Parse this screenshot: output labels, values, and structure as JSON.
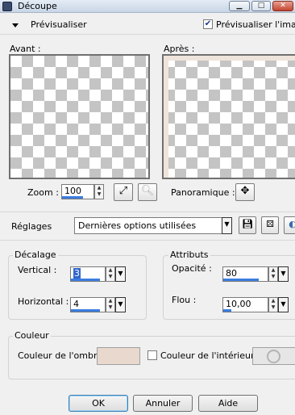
{
  "window": {
    "title": "Découpe",
    "minimize": "▁",
    "maximize": "□",
    "close": "✕"
  },
  "preview": {
    "collapse_icon": "triangle-down",
    "label": "Prévisualiser",
    "show_image_checked": true,
    "show_image_label": "Prévisualiser l'image"
  },
  "panes": {
    "before": "Avant :",
    "after": "Après :"
  },
  "zoom": {
    "label": "Zoom :",
    "value": "100",
    "pan_label": "Panoramique :"
  },
  "settings": {
    "label": "Réglages",
    "preset_value": "Dernières options utilisées"
  },
  "offset": {
    "title": "Décalage",
    "vertical_label": "Vertical :",
    "vertical_value": "3",
    "horizontal_label": "Horizontal :",
    "horizontal_value": "4"
  },
  "attributes": {
    "title": "Attributs",
    "opacity_label": "Opacité :",
    "opacity_value": "80",
    "blur_label": "Flou :",
    "blur_value": "10,00"
  },
  "color": {
    "title": "Couleur",
    "shadow_label": "Couleur de l'ombre :",
    "shadow_swatch": "#e8d8ce",
    "inner_checked": false,
    "inner_label": "Couleur de l'intérieur :"
  },
  "buttons": {
    "ok": "OK",
    "cancel": "Annuler",
    "help": "Aide"
  }
}
